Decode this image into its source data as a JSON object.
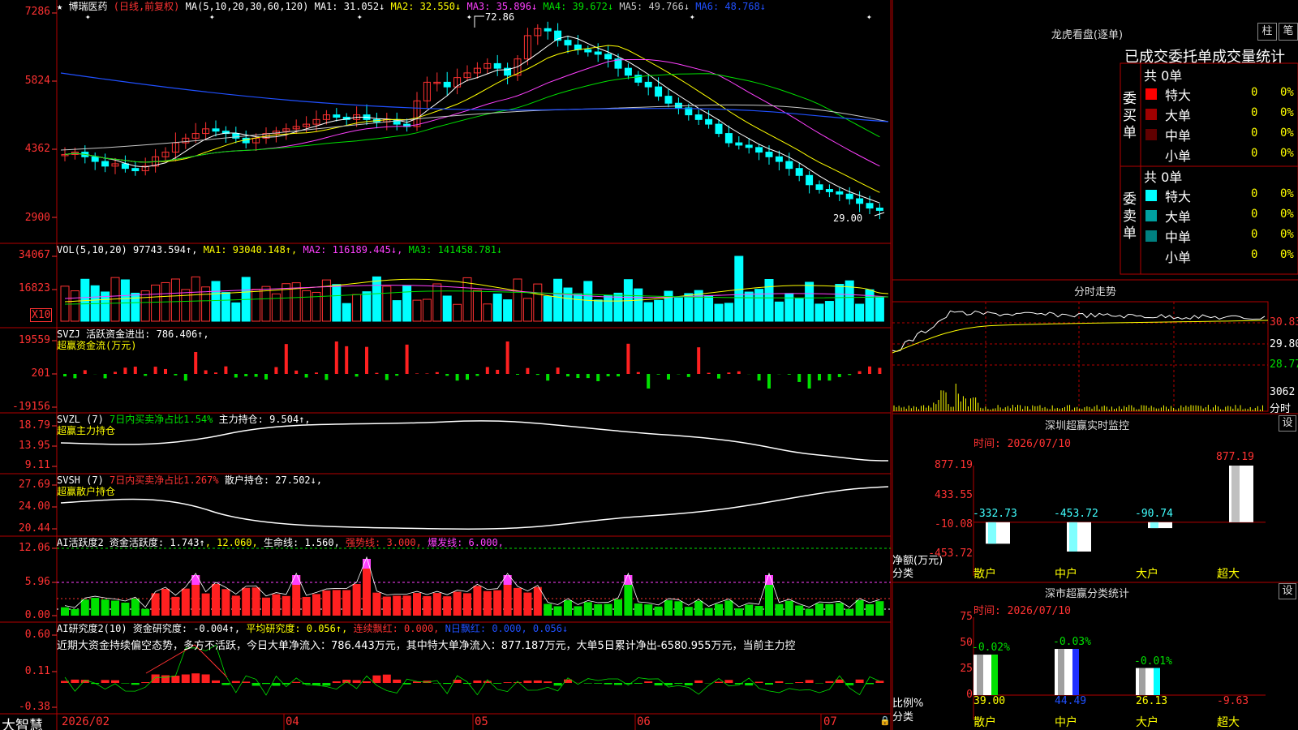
{
  "stock": {
    "name": "博瑞医药",
    "mode": "(日线,前复权)"
  },
  "ma": {
    "prefix": "MA(5,10,20,30,60,120)",
    "items": [
      {
        "label": "MA1: 31.052↓",
        "color": "#ffffff"
      },
      {
        "label": "MA2: 32.550↓",
        "color": "#ffff00"
      },
      {
        "label": "MA3: 35.896↓",
        "color": "#ff40ff"
      },
      {
        "label": "MA4: 39.672↓",
        "color": "#00e000"
      },
      {
        "label": "MA5: 49.766↓",
        "color": "#c8c8c8"
      },
      {
        "label": "MA6: 48.768↓",
        "color": "#2050ff"
      }
    ],
    "high_label": "72.86",
    "low_label": "29.00",
    "yticks": [
      "7286",
      "5824",
      "4362",
      "2900"
    ]
  },
  "vol": {
    "prefix": "VOL(5,10,20)",
    "value": "97743.594↑",
    "ma1": "MA1: 93040.148↑",
    "ma2": "MA2: 116189.445↓",
    "ma3": "MA3: 141458.781↓",
    "yticks": [
      "34067",
      "16823"
    ],
    "unit": "X10"
  },
  "svzj": {
    "prefix": "SVZJ",
    "label": "活跃资金进出: 786.406↑,",
    "sub": "超赢资金流(万元)",
    "yticks": [
      "19559",
      "201",
      "-19156"
    ]
  },
  "svzl": {
    "prefix": "SVZL (7)",
    "ratio": "7日内买卖净占比1.54%",
    "label": "主力持仓: 9.504↑,",
    "sub": "超赢主力持仓",
    "yticks": [
      "18.79",
      "13.95",
      "9.11"
    ]
  },
  "svsh": {
    "prefix": "SVSH (7)",
    "ratio": "7日内买卖净占比1.267%",
    "label": "散户持仓: 27.502↓,",
    "sub": "超赢散户持仓",
    "yticks": [
      "27.69",
      "24.00",
      "20.44"
    ]
  },
  "ai_active": {
    "prefix": "AI活跃度2",
    "label": "资金活跃度: 1.743↑",
    "v2": ", 12.060,",
    "life": "生命线: 1.560,",
    "strong": "强势线: 3.000,",
    "burst": "爆发线: 6.000,",
    "yticks": [
      "12.06",
      "5.96",
      "0.00"
    ]
  },
  "ai_research": {
    "prefix": "AI研究度2(10)",
    "label": "资金研究度: -0.004↑",
    "avg": "平均研究度: 0.056↑",
    "cont": "连续飘红: 0.000,",
    "n": "N日飘红: 0.000, 0.056↓",
    "desc": "近期大资金持续偏空态势，多方不活跃，今日大单净流入：786.443万元，其中特大单净流入：877.187万元，大单5日累计净出-6580.955万元，当前主力控",
    "yticks": [
      "0.60",
      "0.11",
      "-0.38"
    ]
  },
  "footer": {
    "brand": "大智慧",
    "dates": [
      "2026/02",
      "04",
      "05",
      "06",
      "07"
    ]
  },
  "right": {
    "lhb_title": "龙虎看盘(逐单)",
    "btn_bar": "柱",
    "btn_stroke": "笔",
    "deal_title": "已成交委托单成交量统计",
    "buy_label": "委买单",
    "sell_label": "委卖单",
    "buy_total": "共 0单",
    "sell_total": "共 0单",
    "buy_rows": [
      {
        "label": "特大",
        "count": "0",
        "pct": "0%",
        "color": "#ff0000"
      },
      {
        "label": "大单",
        "count": "0",
        "pct": "0%",
        "color": "#a00000"
      },
      {
        "label": "中单",
        "count": "0",
        "pct": "0%",
        "color": "#600000"
      },
      {
        "label": "小单",
        "count": "0",
        "pct": "0%",
        "color": "#000000"
      }
    ],
    "sell_rows": [
      {
        "label": "特大",
        "count": "0",
        "pct": "0%",
        "color": "#00ffff"
      },
      {
        "label": "大单",
        "count": "0",
        "pct": "0%",
        "color": "#00a0a0"
      },
      {
        "label": "中单",
        "count": "0",
        "pct": "0%",
        "color": "#008080"
      },
      {
        "label": "小单",
        "count": "0",
        "pct": "0%",
        "color": "#000000"
      }
    ],
    "intraday_title": "分时走势",
    "intraday_yticks": [
      "30.83",
      "29.80",
      "28.77",
      "3062"
    ],
    "intraday_unit": "分时",
    "monitor_title": "深圳超赢实时监控",
    "set_label": "设",
    "monitor_time": "时间: 2026/07/10",
    "monitor_yticks": [
      "877.19",
      "433.55",
      "-10.08",
      "-453.72"
    ],
    "monitor_axis": "净额(万元)",
    "monitor_axis2": "分类",
    "monitor_bars": [
      {
        "name": "散户",
        "value": -332.73,
        "label": "-332.73"
      },
      {
        "name": "中户",
        "value": -453.72,
        "label": "-453.72"
      },
      {
        "name": "大户",
        "value": -90.74,
        "label": "-90.74"
      },
      {
        "name": "超大",
        "value": 877.19,
        "label": "877.19"
      }
    ],
    "class_title": "深市超赢分类统计",
    "class_time": "时间: 2026/07/10",
    "class_yticks": [
      "75",
      "50",
      "25",
      "0"
    ],
    "class_axis": "比例%",
    "class_axis2": "分类",
    "class_bars": [
      {
        "name": "散户",
        "value": 39.0,
        "label": "39.00",
        "delta": "-0.02%"
      },
      {
        "name": "中户",
        "value": 44.49,
        "label": "44.49",
        "delta": "-0.03%"
      },
      {
        "name": "大户",
        "value": 26.13,
        "label": "26.13",
        "delta": "-0.01%"
      },
      {
        "name": "超大",
        "value": -9.63,
        "label": "-9.63",
        "delta": ""
      }
    ]
  },
  "chart_data": [
    {
      "type": "bar",
      "title": "深圳超赢实时监控",
      "categories": [
        "散户",
        "中户",
        "大户",
        "超大"
      ],
      "values": [
        -332.73,
        -453.72,
        -90.74,
        877.19
      ],
      "ylabel": "净额(万元)",
      "ylim": [
        -453.72,
        877.19
      ]
    },
    {
      "type": "bar",
      "title": "深市超赢分类统计",
      "categories": [
        "散户",
        "中户",
        "大户",
        "超大"
      ],
      "values": [
        39.0,
        44.49,
        26.13,
        -9.63
      ],
      "ylabel": "比例%",
      "ylim": [
        0,
        75
      ]
    }
  ]
}
